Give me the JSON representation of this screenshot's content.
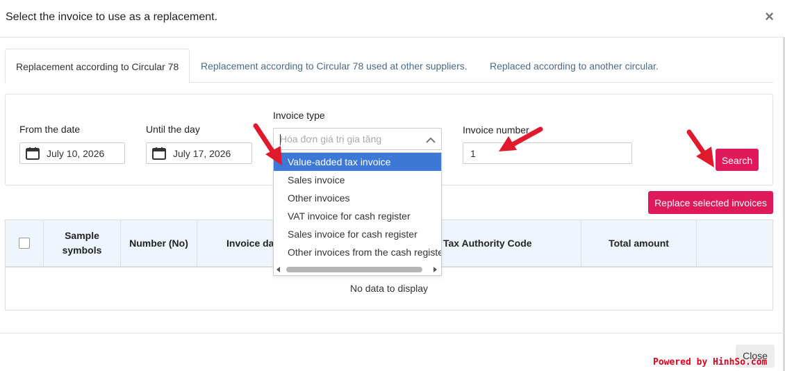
{
  "dialog": {
    "title": "Select the invoice to use as a replacement.",
    "close_symbol": "×"
  },
  "tabs": [
    {
      "label": "Replacement according to Circular 78",
      "active": true
    },
    {
      "label": "Replacement according to Circular 78 used at other suppliers.",
      "active": false
    },
    {
      "label": "Replaced according to another circular.",
      "active": false
    }
  ],
  "filters": {
    "from_date_label": "From the date",
    "from_date_value": "July 10, 2026",
    "until_date_label": "Until the day",
    "until_date_value": "July 17, 2026",
    "invoice_type_label": "Invoice type",
    "invoice_type_placeholder": "Hóa đơn giá trị gia tăng",
    "invoice_number_label": "Invoice number",
    "invoice_number_value": "1",
    "search_button": "Search",
    "calendar_icon": "calendar-icon"
  },
  "invoice_type_options": [
    {
      "label": "Value-added tax invoice",
      "selected": true
    },
    {
      "label": "Sales invoice",
      "selected": false
    },
    {
      "label": "Other invoices",
      "selected": false
    },
    {
      "label": "VAT invoice for cash register",
      "selected": false
    },
    {
      "label": "Sales invoice for cash register",
      "selected": false
    },
    {
      "label": "Other invoices from the cash register",
      "selected": false
    }
  ],
  "actions": {
    "replace_button": "Replace selected invoices"
  },
  "table": {
    "columns": [
      "Sample symbols",
      "Number (No)",
      "Invoice date",
      "Tax Authority Code",
      "Total amount",
      ""
    ],
    "empty_text": "No data to display"
  },
  "footer": {
    "close_button": "Close",
    "watermark": "Powered by HinhSo.com"
  },
  "colors": {
    "accent": "#e0195a",
    "selected_option": "#3e78d6",
    "table_header_bg": "#eef5fd",
    "annotation_arrow": "#e0192d"
  }
}
